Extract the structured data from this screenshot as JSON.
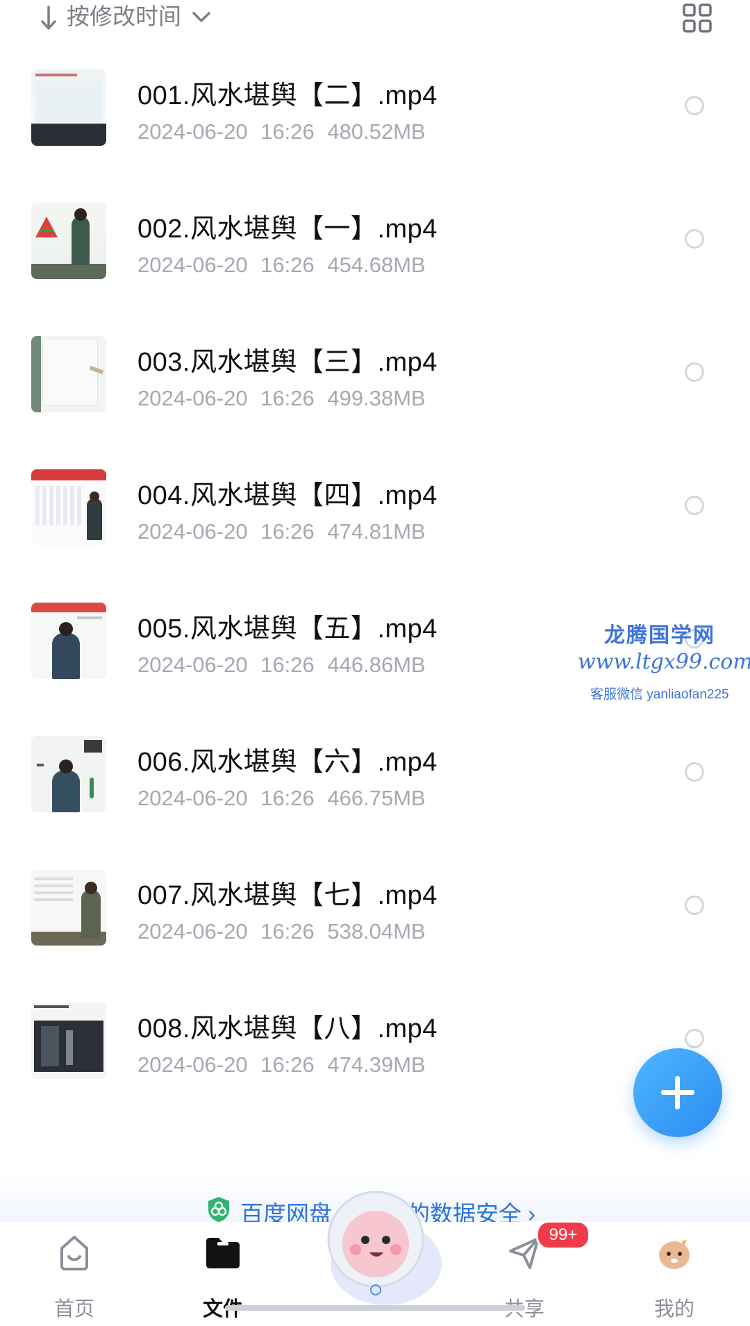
{
  "sortbar": {
    "label": "按修改时间",
    "arrow_icon": "arrow-down-icon",
    "chevron_icon": "chevron-down-icon",
    "view_icon": "grid-view-icon"
  },
  "files": [
    {
      "name": "001.风水堪舆【二】.mp4",
      "date": "2024-06-20",
      "time": "16:26",
      "size": "480.52MB"
    },
    {
      "name": "002.风水堪舆【一】.mp4",
      "date": "2024-06-20",
      "time": "16:26",
      "size": "454.68MB"
    },
    {
      "name": "003.风水堪舆【三】.mp4",
      "date": "2024-06-20",
      "time": "16:26",
      "size": "499.38MB"
    },
    {
      "name": "004.风水堪舆【四】.mp4",
      "date": "2024-06-20",
      "time": "16:26",
      "size": "474.81MB"
    },
    {
      "name": "005.风水堪舆【五】.mp4",
      "date": "2024-06-20",
      "time": "16:26",
      "size": "446.86MB"
    },
    {
      "name": "006.风水堪舆【六】.mp4",
      "date": "2024-06-20",
      "time": "16:26",
      "size": "466.75MB"
    },
    {
      "name": "007.风水堪舆【七】.mp4",
      "date": "2024-06-20",
      "time": "16:26",
      "size": "538.04MB"
    },
    {
      "name": "008.风水堪舆【八】.mp4",
      "date": "2024-06-20",
      "time": "16:26",
      "size": "474.39MB"
    }
  ],
  "watermark": {
    "title": "龙腾国学网",
    "url": "www.ltgx99.com",
    "wechat": "客服微信 yanliaofan225"
  },
  "fab": {
    "icon": "plus-icon"
  },
  "banner": {
    "text_left": "百度网盘",
    "text_right": "的数据安全",
    "chevron": "›"
  },
  "tabs": [
    {
      "label": "首页",
      "icon": "home-icon",
      "active": false
    },
    {
      "label": "文件",
      "icon": "folder-icon",
      "active": true
    },
    {
      "label": "共享",
      "icon": "send-icon",
      "active": false
    },
    {
      "label": "我的",
      "icon": "profile-avatar-icon",
      "active": false
    }
  ],
  "share_badge": "99+",
  "colors": {
    "accent": "#2b8cf2",
    "text_primary": "#111111",
    "text_secondary": "#a4a9b2",
    "badge": "#f23b4a",
    "watermark": "#3e74d8"
  }
}
